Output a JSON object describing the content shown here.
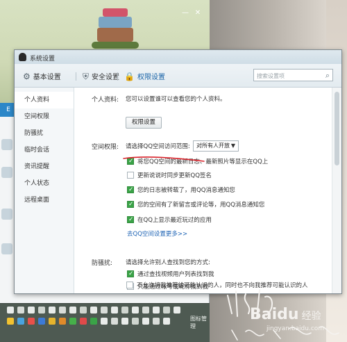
{
  "dialog": {
    "title": "系统设置",
    "tabs": [
      {
        "label": "基本设置",
        "icon": "gear-icon"
      },
      {
        "label": "安全设置",
        "icon": "shield-icon"
      },
      {
        "label": "权限设置",
        "icon": "lock-icon"
      }
    ],
    "search_placeholder": "搜索设置项",
    "nav": [
      "个人资料",
      "空间权限",
      "防骚扰",
      "临时会话",
      "资讯提醒",
      "个人状态",
      "远程桌面"
    ],
    "profile": {
      "label": "个人资料:",
      "desc": "您可以设置谁可以查看您的个人资料。",
      "button": "权限设置"
    },
    "space": {
      "label": "空间权限:",
      "prompt": "请选择QQ空间访问范围:",
      "select_value": "对所有人开放",
      "options": [
        {
          "label": "将您QQ空间的最新日志、最新照片等显示在QQ上",
          "checked": true
        },
        {
          "label": "更新说说时同步更新QQ签名",
          "checked": false
        },
        {
          "label": "您的日志被转载了，用QQ消息通知您",
          "checked": true
        },
        {
          "label": "您的空间有了新留言或评论等，用QQ消息通知您",
          "checked": true
        },
        {
          "label": "在QQ上显示最近玩过的应用",
          "checked": true
        }
      ],
      "more_link": "去QQ空间设置更多>>"
    },
    "anti": {
      "label": "防骚扰:",
      "prompt": "请选择允许别人查找到您的方式:",
      "options": [
        {
          "label": "通过查找视频用户列表找到我",
          "checked": true
        },
        {
          "label": "只能通过帐号或昵称找到我",
          "checked": false
        },
        {
          "label": "不允许将我推荐给可能认识的人，同时也不向我推荐可能认识的人",
          "checked": false
        }
      ]
    }
  },
  "background": {
    "toolbar_label": "图标管理",
    "side_tab": "E"
  },
  "watermark": {
    "logo": "Baidu",
    "cn": "经验",
    "url": "jingyan.baidu.com"
  },
  "colors": {
    "accent": "#1a64a8",
    "check_green": "#3aa347",
    "link": "#1f64b5",
    "red_pen": "#d8222a"
  }
}
